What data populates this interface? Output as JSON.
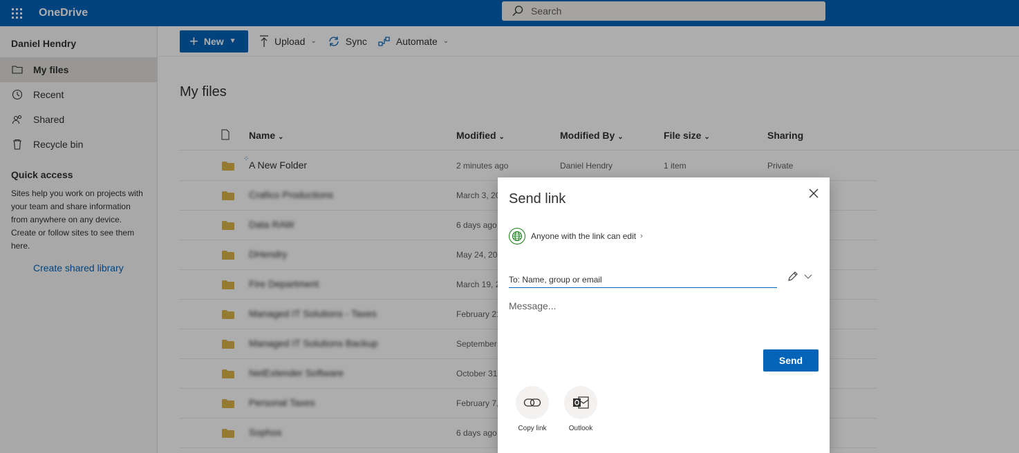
{
  "app": {
    "name": "OneDrive"
  },
  "search": {
    "placeholder": "Search"
  },
  "user": {
    "name": "Daniel Hendry"
  },
  "nav": {
    "items": [
      {
        "label": "My files",
        "icon": "folder-icon"
      },
      {
        "label": "Recent",
        "icon": "clock-icon"
      },
      {
        "label": "Shared",
        "icon": "people-icon"
      },
      {
        "label": "Recycle bin",
        "icon": "trash-icon"
      }
    ]
  },
  "quick_access": {
    "title": "Quick access",
    "description": "Sites help you work on projects with your team and share information from anywhere on any device. Create or follow sites to see them here.",
    "link": "Create shared library"
  },
  "toolbar": {
    "new": "New",
    "upload": "Upload",
    "sync": "Sync",
    "automate": "Automate"
  },
  "main": {
    "title": "My files"
  },
  "table": {
    "headers": {
      "name": "Name",
      "modified": "Modified",
      "modified_by": "Modified By",
      "file_size": "File size",
      "sharing": "Sharing"
    },
    "rows": [
      {
        "name": "A New Folder",
        "modified": "2 minutes ago",
        "modified_by": "Daniel Hendry",
        "file_size": "1 item",
        "sharing": "Private"
      },
      {
        "name": "Crafico Productions",
        "modified": "March 3, 20"
      },
      {
        "name": "Data RAW",
        "modified": "6 days ago"
      },
      {
        "name": "DHendry",
        "modified": "May 24, 20"
      },
      {
        "name": "Fire Department",
        "modified": "March 19, 2"
      },
      {
        "name": "Managed IT Solutions - Taxes",
        "modified": "February 21"
      },
      {
        "name": "Managed IT Solutions Backup",
        "modified": "September"
      },
      {
        "name": "NetExtender Software",
        "modified": "October 31"
      },
      {
        "name": "Personal Taxes",
        "modified": "February 7,"
      },
      {
        "name": "Sophos",
        "modified": "6 days ago"
      }
    ]
  },
  "dialog": {
    "title": "Send link",
    "permission": "Anyone with the link can edit",
    "to_placeholder": "To: Name, group or email",
    "message_placeholder": "Message...",
    "send": "Send",
    "options": [
      {
        "label": "Copy link",
        "icon": "link-icon"
      },
      {
        "label": "Outlook",
        "icon": "outlook-icon"
      }
    ]
  },
  "colors": {
    "brand": "#0364b8",
    "folder": "#dcb44a",
    "overlay": "rgba(0,0,0,0.32)"
  }
}
